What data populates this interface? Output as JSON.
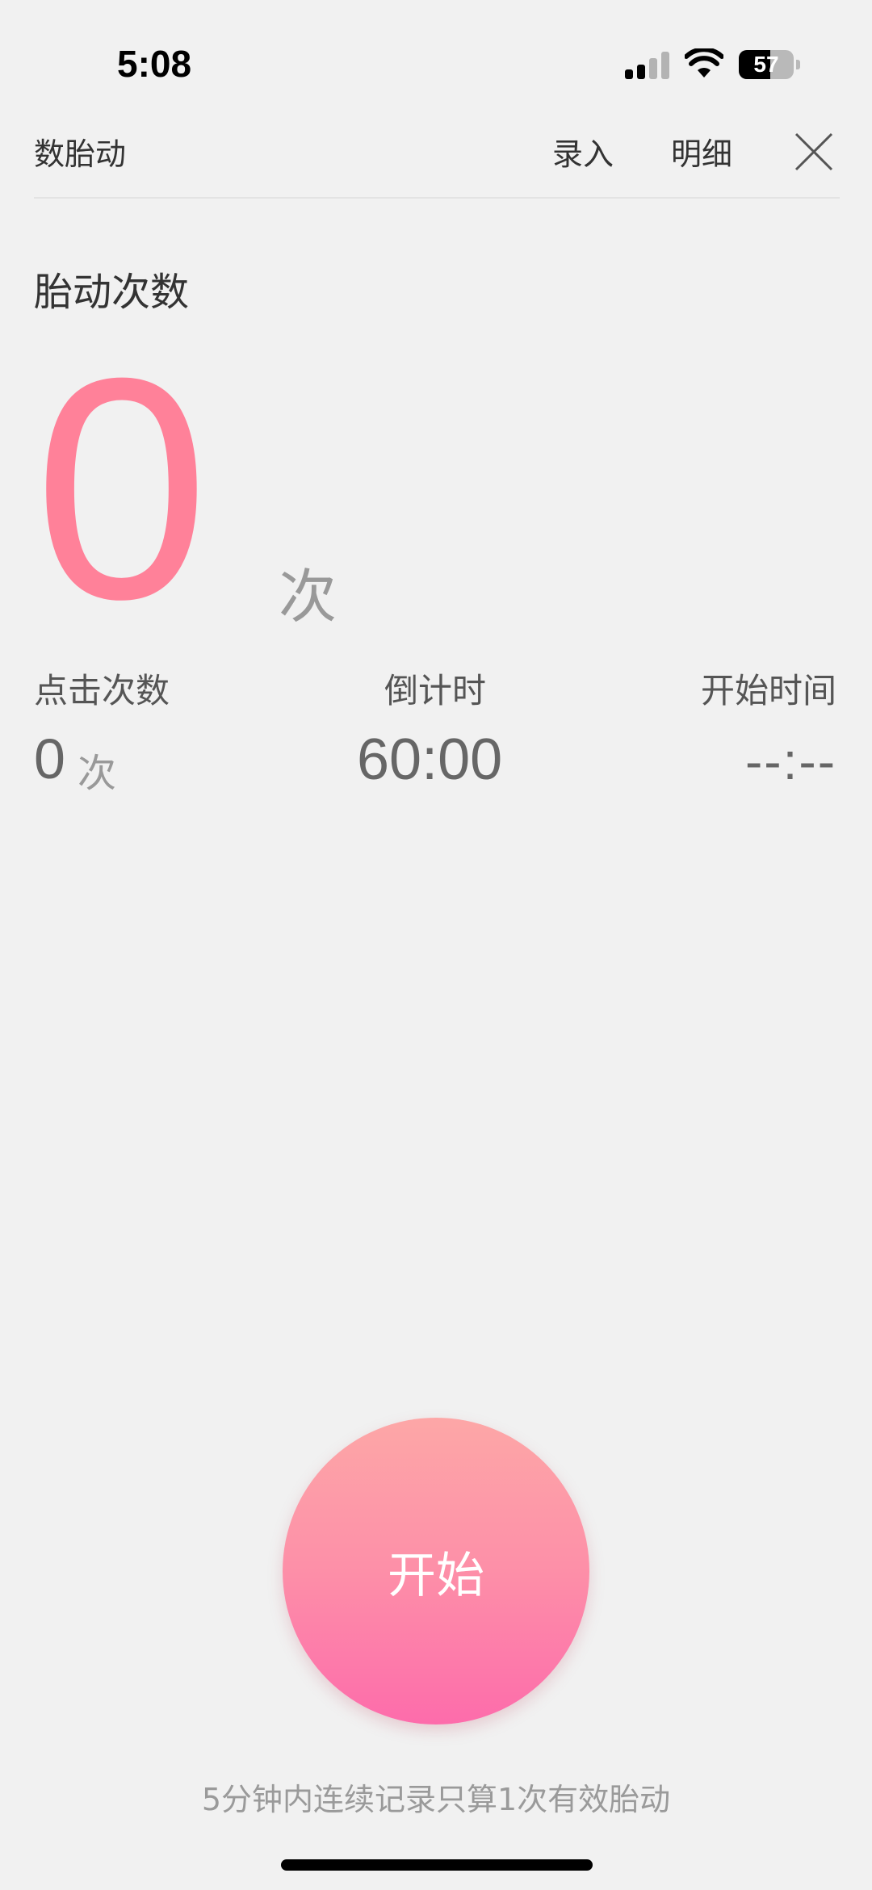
{
  "status_bar": {
    "time": "5:08",
    "battery_percent": "57",
    "battery_level": 0.57
  },
  "header": {
    "title": "数胎动",
    "entry_label": "录入",
    "detail_label": "明细",
    "close_icon": "close-icon"
  },
  "count": {
    "label": "胎动次数",
    "value": "0",
    "unit": "次"
  },
  "stats": {
    "clicks_label": "点击次数",
    "clicks_value": "0",
    "clicks_unit": "次",
    "timer_label": "倒计时",
    "timer_value": "60:00",
    "start_label": "开始时间",
    "start_value": "--:--"
  },
  "start_button": {
    "label": "开始"
  },
  "hint": "5分钟内连续记录只算1次有效胎动",
  "colors": {
    "accent": "#ff8199",
    "button_top": "#fda7a7",
    "button_bottom": "#fd6cab",
    "background": "#f1f1f1"
  }
}
